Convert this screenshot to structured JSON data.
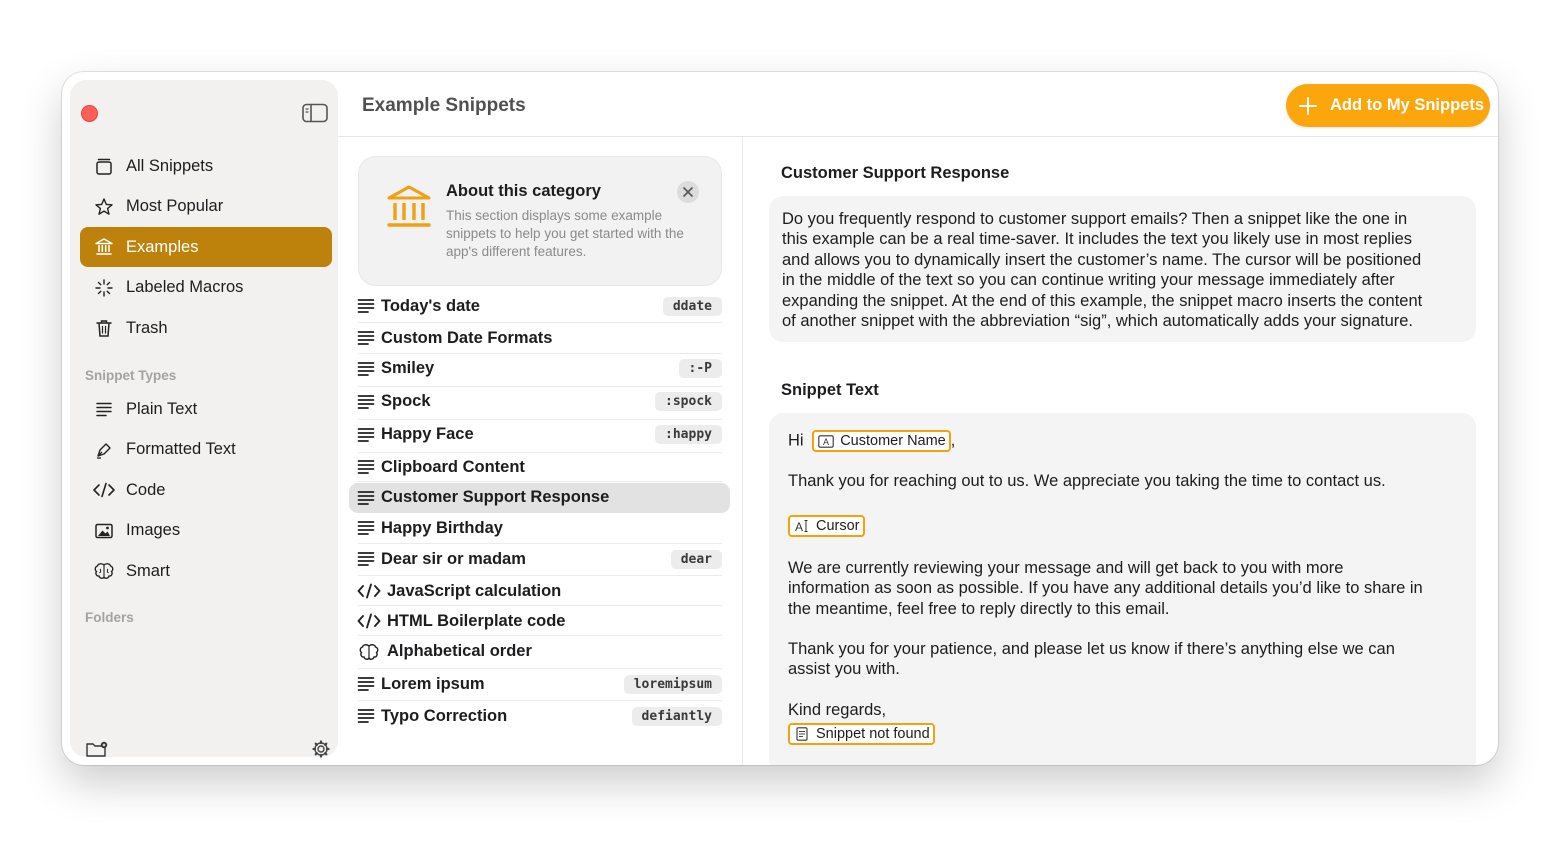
{
  "sidebar": {
    "items": [
      {
        "label": "All Snippets",
        "icon": "stack-icon"
      },
      {
        "label": "Most Popular",
        "icon": "star-icon"
      },
      {
        "label": "Examples",
        "icon": "bank-icon"
      },
      {
        "label": "Labeled Macros",
        "icon": "sparkle-icon"
      },
      {
        "label": "Trash",
        "icon": "trash-icon"
      }
    ],
    "active_index": 2,
    "snippet_types_title": "Snippet Types",
    "types": [
      {
        "label": "Plain Text",
        "icon": "lines-icon"
      },
      {
        "label": "Formatted Text",
        "icon": "pen-icon"
      },
      {
        "label": "Code",
        "icon": "code-icon"
      },
      {
        "label": "Images",
        "icon": "image-icon"
      },
      {
        "label": "Smart",
        "icon": "brain-icon"
      }
    ],
    "folders_title": "Folders"
  },
  "header": {
    "title": "Example Snippets",
    "add_button": "Add to My Snippets"
  },
  "about": {
    "title": "About this category",
    "text": "This section displays some example snippets to help you get started with the app's different features."
  },
  "snippets": [
    {
      "name": "Today's date",
      "abbr": "ddate",
      "icon": "lines-icon"
    },
    {
      "name": "Custom Date Formats",
      "abbr": "",
      "icon": "lines-icon"
    },
    {
      "name": "Smiley",
      "abbr": ":-P",
      "icon": "lines-icon"
    },
    {
      "name": "Spock",
      "abbr": ":spock",
      "icon": "lines-icon"
    },
    {
      "name": "Happy Face",
      "abbr": ":happy",
      "icon": "lines-icon"
    },
    {
      "name": "Clipboard Content",
      "abbr": "",
      "icon": "lines-icon"
    },
    {
      "name": "Customer Support Response",
      "abbr": "",
      "icon": "lines-icon"
    },
    {
      "name": "Happy Birthday",
      "abbr": "",
      "icon": "lines-icon"
    },
    {
      "name": "Dear sir or madam",
      "abbr": "dear",
      "icon": "lines-icon"
    },
    {
      "name": "JavaScript calculation",
      "abbr": "",
      "icon": "code-icon"
    },
    {
      "name": "HTML Boilerplate code",
      "abbr": "",
      "icon": "code-icon"
    },
    {
      "name": "Alphabetical order",
      "abbr": "",
      "icon": "brain-icon"
    },
    {
      "name": "Lorem ipsum",
      "abbr": "loremipsum",
      "icon": "lines-icon"
    },
    {
      "name": "Typo Correction",
      "abbr": "defiantly",
      "icon": "lines-icon"
    }
  ],
  "selected_snippet_index": 6,
  "detail": {
    "title": "Customer Support Response",
    "description_lines": [
      "Do you frequently respond to customer support emails? Then a snippet like the one in",
      "this example can be a real time-saver. It includes the text you likely use in most replies",
      "and allows you to dynamically insert the customer’s name. The cursor will be positioned",
      "in the middle of the text so you can continue writing your message immediately after",
      "expanding the snippet. At the end of this example, the snippet macro inserts the content",
      "of another snippet with the abbreviation “sig”, which automatically adds your signature."
    ],
    "snippet_text_title": "Snippet Text",
    "greeting": "Hi",
    "token_customer_name": "Customer Name",
    "comma": ",",
    "line_thanks": "Thank you for reaching out to us. We appreciate you taking the time to contact us.",
    "token_cursor": "Cursor",
    "para_reviewing_lines": [
      "We are currently reviewing your message and will get back to you with more",
      "information as soon as possible. If you have any additional details you’d like to share in",
      "the meantime, feel free to reply directly to this email."
    ],
    "para_patience_lines": [
      "Thank you for your patience, and please let us know if there’s anything else we can",
      "assist you with."
    ],
    "closing": "Kind regards,",
    "token_snippet": "Snippet not found"
  },
  "colors": {
    "accent": "#bd820b",
    "button": "#fba60c",
    "token_border": "#f3a20e",
    "close_dot": "#ff5f57"
  }
}
